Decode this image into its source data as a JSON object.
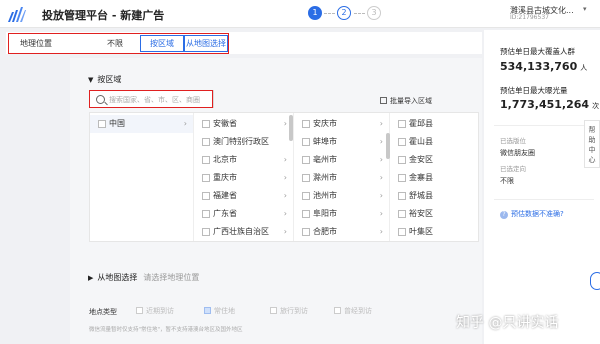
{
  "header": {
    "title": "投放管理平台 - 新建广告",
    "steps": [
      "1",
      "2",
      "3"
    ],
    "account_name": "濉溪县古城文化...",
    "account_id": "ID:21796537"
  },
  "geo": {
    "label": "地理位置",
    "options": [
      "不限",
      "按区域",
      "从地图选择"
    ]
  },
  "region": {
    "title": "按区域",
    "search_placeholder": "搜索国家、省、市、区、商圈",
    "batch_import": "批量导入区域",
    "col1": [
      "中国"
    ],
    "col2": [
      "安徽省",
      "澳门特别行政区",
      "北京市",
      "重庆市",
      "福建省",
      "广东省",
      "广西壮族自治区"
    ],
    "col3": [
      "安庆市",
      "蚌埠市",
      "亳州市",
      "滁州市",
      "池州市",
      "阜阳市",
      "合肥市"
    ],
    "col4": [
      "霍邱县",
      "霍山县",
      "金安区",
      "金寨县",
      "舒城县",
      "裕安区",
      "叶集区"
    ]
  },
  "map_select": {
    "title": "从地图选择",
    "placeholder": "请选择地理位置"
  },
  "location_type": {
    "label": "地点类型",
    "options": [
      "近期到访",
      "常住地",
      "旅行到访",
      "曾经到访"
    ],
    "note": "微信流量暂时仅支持\"常住地\"，暂不支持港澳台地区及国外地区"
  },
  "estimate": {
    "coverage_label": "预估单日最大覆盖人群",
    "coverage_value": "534,133,760",
    "coverage_unit": "人",
    "exposure_label": "预估单日最大曝光量",
    "exposure_value": "1,773,451,264",
    "exposure_unit": "次",
    "selected_placement_label": "已选版位",
    "selected_placement_value": "微信朋友圈",
    "selected_direction_label": "已选定向",
    "selected_direction_value": "不限",
    "question": "预估数据不准确?"
  },
  "help_tab": [
    "帮",
    "助",
    "中",
    "心"
  ],
  "watermark": "知乎 @只讲实话",
  "colors": {
    "accent": "#2b6de5",
    "highlight": "#e02020"
  }
}
